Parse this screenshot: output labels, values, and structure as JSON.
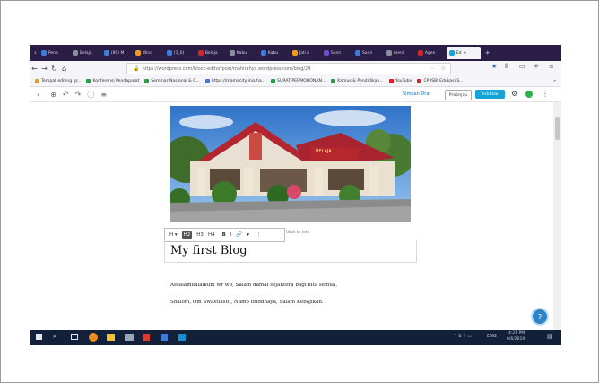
{
  "browser": {
    "tabs": [
      {
        "label": "Pena",
        "color": "#3b7dd8"
      },
      {
        "label": "Belaja",
        "color": "#8a8fa0"
      },
      {
        "label": "(89) M",
        "color": "#3b7dd8"
      },
      {
        "label": "Wind",
        "color": "#f29a1f"
      },
      {
        "label": "(1_0)",
        "color": "#3b7dd8"
      },
      {
        "label": "Belaja",
        "color": "#d6242b"
      },
      {
        "label": "Kabu",
        "color": "#8a8fa0"
      },
      {
        "label": "Kabu",
        "color": "#3b7dd8"
      },
      {
        "label": "Jati b",
        "color": "#f29a1f"
      },
      {
        "label": "Sunn",
        "color": "#6a4fd1"
      },
      {
        "label": "Sunn",
        "color": "#3b7dd8"
      },
      {
        "label": "meni",
        "color": "#8a8fa0"
      },
      {
        "label": "Agen",
        "color": "#d6242b"
      },
      {
        "label": "Ed",
        "color": "#16a3d8",
        "active": true
      }
    ],
    "new_tab": "+",
    "url": "https://wordpress.com/block-editor/post/mahirahys.wordpress.com/blog/24",
    "url_more": "···",
    "bookmarks": [
      {
        "label": "Tempat editing gr...",
        "color": "#e0a21f"
      },
      {
        "label": "Konferensi Pendaparat",
        "color": "#2e9b47"
      },
      {
        "label": "Seminar Nasional & C...",
        "color": "#2e9b47"
      },
      {
        "label": "https://mamacitylinsuha...",
        "color": "#3b7dd8"
      },
      {
        "label": "SURAT PERMOHONAN...",
        "color": "#2e9b47"
      },
      {
        "label": "Kamus & Pendidikan...",
        "color": "#2e9b47"
      },
      {
        "label": "YouTube",
        "color": "#d6242b"
      },
      {
        "label": "CP ISBI Edukasi S...",
        "color": "#d6242b"
      }
    ],
    "bookmarks_more": "»"
  },
  "editor": {
    "toolbar_icons": [
      "back-arrow-icon",
      "add-block-icon",
      "undo-icon",
      "redo-icon",
      "info-icon",
      "outline-icon"
    ],
    "save_draft": "Simpan Draf",
    "preview": "Pratinjau",
    "publish": "Terbitkan",
    "block_toolbar": {
      "heading_levels": [
        "H ▾",
        "H2",
        "H3",
        "H4"
      ],
      "bold": "B",
      "italic": "I",
      "link": "🔗",
      "more": "▾",
      "options": "⋮"
    },
    "alt_label": "Ubah ke teks",
    "heading": "My first Blog",
    "paragraph_lines": [
      "Assalamualaikum wr wb, Salam damai sejahtera bagi kita semua,",
      "Shalom, Om Swastiastu, Namo Buddhaya, Salam Kebajikan."
    ],
    "help_label": "?"
  },
  "taskbar": {
    "clock_time": "4:21 PM",
    "clock_date": "6/6/2019",
    "tray_lang": "ENG"
  }
}
